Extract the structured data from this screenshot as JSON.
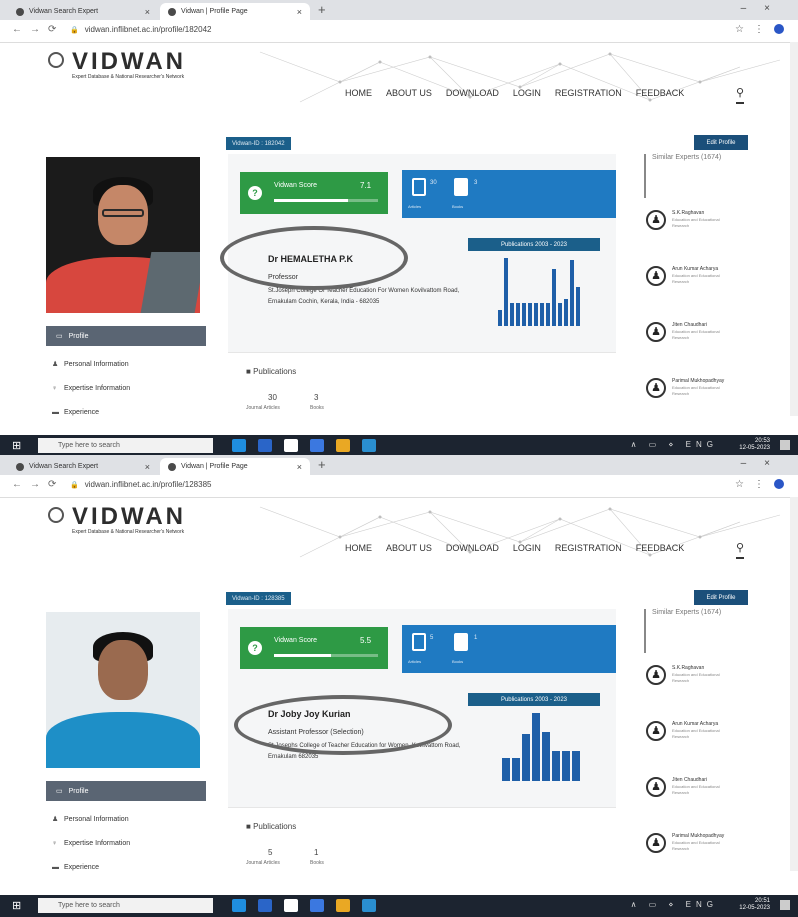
{
  "shots": [
    {
      "tabs": [
        "Vidwan Search Expert",
        "Vidwan | Profile Page"
      ],
      "url": "vidwan.inflibnet.ac.in/profile/182042",
      "brand": {
        "name": "VIDWAN",
        "tagline": "Expert Database & National Researcher's Network"
      },
      "menu": [
        "HOME",
        "ABOUT US",
        "DOWNLOAD",
        "LOGIN",
        "REGISTRATION",
        "FEEDBACK"
      ],
      "vidwan_id": "Vidwan-ID : 182042",
      "edit_profile": "Edit Profile",
      "score_label": "Vidwan Score",
      "score_value": "7.1",
      "score_fraction": 0.71,
      "counts": [
        {
          "n": "30",
          "s": "Articles"
        },
        {
          "n": "3",
          "s": "Books"
        }
      ],
      "pub_header": "Publications 2003 - 2023",
      "hist": [
        14,
        60,
        20,
        20,
        20,
        20,
        20,
        20,
        20,
        50,
        20,
        24,
        58,
        34
      ],
      "name": "Dr HEMALETHA P.K",
      "designation": "Professor",
      "address": "St.Joseph College Of Teacher Education For Women Kovilvattom Road, Ernakulam Cochin, Kerala, India - 682035",
      "side_links": [
        "Profile",
        "Personal Information",
        "Expertise Information",
        "Experience"
      ],
      "publications_title": "Publications",
      "pub_counts": [
        {
          "n": "30",
          "s": "Journal Articles"
        },
        {
          "n": "3",
          "s": "Books"
        }
      ],
      "similar_title": "Similar Experts (1674)",
      "experts": [
        {
          "name": "S.K.Raghavan",
          "dept": "Education and Educational Research"
        },
        {
          "name": "Arun Kumar Acharya",
          "dept": "Education and Educational Research"
        },
        {
          "name": "Jiten Chaudhari",
          "dept": "Education and Educational Research"
        },
        {
          "name": "Parimal Mukhopadhyay",
          "dept": "Education and Educational Research"
        }
      ],
      "taskbar_search": "Type here to search",
      "time": "20:53",
      "date": "12-05-2023",
      "lang": "ENG"
    },
    {
      "tabs": [
        "Vidwan Search Expert",
        "Vidwan | Profile Page"
      ],
      "url": "vidwan.inflibnet.ac.in/profile/128385",
      "brand": {
        "name": "VIDWAN",
        "tagline": "Expert Database & National Researcher's Network"
      },
      "menu": [
        "HOME",
        "ABOUT US",
        "DOWNLOAD",
        "LOGIN",
        "REGISTRATION",
        "FEEDBACK"
      ],
      "vidwan_id": "Vidwan-ID : 128385",
      "edit_profile": "Edit Profile",
      "score_label": "Vidwan Score",
      "score_value": "5.5",
      "score_fraction": 0.55,
      "counts": [
        {
          "n": "5",
          "s": "Articles"
        },
        {
          "n": "1",
          "s": "Books"
        }
      ],
      "pub_header": "Publications 2003 - 2023",
      "hist": [
        20,
        20,
        40,
        58,
        42,
        26,
        26,
        26
      ],
      "name": "Dr Joby Joy Kurian",
      "designation": "Assistant Professor (Selection)",
      "address": "St.Josephs College of Teacher Education for Women, Kovilvattom Road, Ernakulam 682035",
      "side_links": [
        "Profile",
        "Personal Information",
        "Expertise Information",
        "Experience"
      ],
      "publications_title": "Publications",
      "pub_counts": [
        {
          "n": "5",
          "s": "Journal Articles"
        },
        {
          "n": "1",
          "s": "Books"
        }
      ],
      "similar_title": "Similar Experts (1674)",
      "experts": [
        {
          "name": "S.K.Raghavan",
          "dept": "Education and Educational Research"
        },
        {
          "name": "Arun Kumar Acharya",
          "dept": "Education and Educational Research"
        },
        {
          "name": "Jiten Chaudhari",
          "dept": "Education and Educational Research"
        },
        {
          "name": "Parimal Mukhopadhyay",
          "dept": "Education and Educational Research"
        }
      ],
      "taskbar_search": "Type here to search",
      "time": "20:51",
      "date": "12-05-2023",
      "lang": "ENG"
    }
  ],
  "colors": {
    "green": "#2e9a45",
    "blue": "#1f7ac2",
    "navy": "#1b5f8a",
    "taskbar": "#1c2430"
  }
}
